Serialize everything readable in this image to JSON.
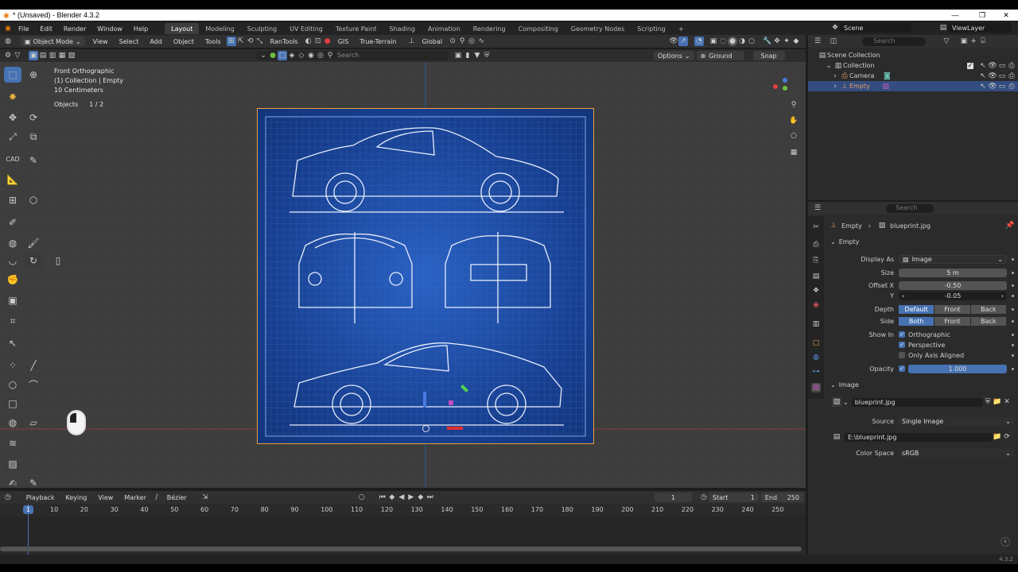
{
  "window": {
    "title": "* (Unsaved) - Blender 4.3.2"
  },
  "menus": [
    "File",
    "Edit",
    "Render",
    "Window",
    "Help"
  ],
  "workspaces": [
    "Layout",
    "Modeling",
    "Sculpting",
    "UV Editing",
    "Texture Paint",
    "Shading",
    "Animation",
    "Rendering",
    "Compositing",
    "Geometry Nodes",
    "Scripting"
  ],
  "scene": {
    "label": "Scene",
    "view_layer": "ViewLayer"
  },
  "viewport_header": {
    "mode": "Object Mode",
    "menus": [
      "View",
      "Select",
      "Add",
      "Object",
      "Tools"
    ],
    "ran_tools": "RanTools",
    "gis": "GIS",
    "true_terrain": "True-Terrain",
    "orientation": "Global",
    "search_placeholder": "Search",
    "options": "Options",
    "ground": "Ground",
    "snap": "Snap"
  },
  "overlay_info": {
    "view_name": "Front Orthographic",
    "collection": "(1) Collection | Empty",
    "scale": "10 Centimeters",
    "objects_label": "Objects",
    "objects_value": "1 / 2"
  },
  "outliner": {
    "search_placeholder": "Search",
    "rows": [
      {
        "label": "Scene Collection"
      },
      {
        "label": "Collection"
      },
      {
        "label": "Camera"
      },
      {
        "label": "Empty"
      }
    ]
  },
  "properties": {
    "search_placeholder": "Search",
    "breadcrumb_object": "Empty",
    "breadcrumb_data": "blueprint.jpg",
    "empty_section": "Empty",
    "display_as_label": "Display As",
    "display_as_value": "Image",
    "size_label": "Size",
    "size_value": "5 m",
    "offset_x_label": "Offset X",
    "offset_x_value": "-0.50",
    "offset_y_label": "Y",
    "offset_y_value": "-0.05",
    "depth_label": "Depth",
    "depth_options": [
      "Default",
      "Front",
      "Back"
    ],
    "side_label": "Side",
    "side_options": [
      "Both",
      "Front",
      "Back"
    ],
    "show_in_label": "Show In",
    "show_orthographic": "Orthographic",
    "show_perspective": "Perspective",
    "show_axis_aligned": "Only Axis Aligned",
    "opacity_label": "Opacity",
    "opacity_value": "1.000",
    "opacity_fraction": 1.0,
    "image_section": "Image",
    "image_name": "blueprint.jpg",
    "source_label": "Source",
    "source_value": "Single Image",
    "filepath": "E:\\blueprint.jpg",
    "color_space_label": "Color Space",
    "color_space_value": "sRGB"
  },
  "timeline": {
    "menus": [
      "Playback",
      "Keying",
      "View",
      "Marker"
    ],
    "interpolation": "Bézier",
    "current_frame": "1",
    "start_label": "Start",
    "start_value": "1",
    "end_label": "End",
    "end_value": "250",
    "marker_label": "1",
    "ticks": [
      "10",
      "20",
      "30",
      "40",
      "50",
      "60",
      "70",
      "80",
      "90",
      "100",
      "110",
      "120",
      "130",
      "140",
      "150",
      "160",
      "170",
      "180",
      "190",
      "200",
      "210",
      "220",
      "230",
      "240",
      "250"
    ]
  },
  "status": {
    "version": "4.3.2"
  },
  "colors": {
    "accent": "#4772b3",
    "blueprint": "#1f4aa0",
    "selection": "#f0a030"
  }
}
